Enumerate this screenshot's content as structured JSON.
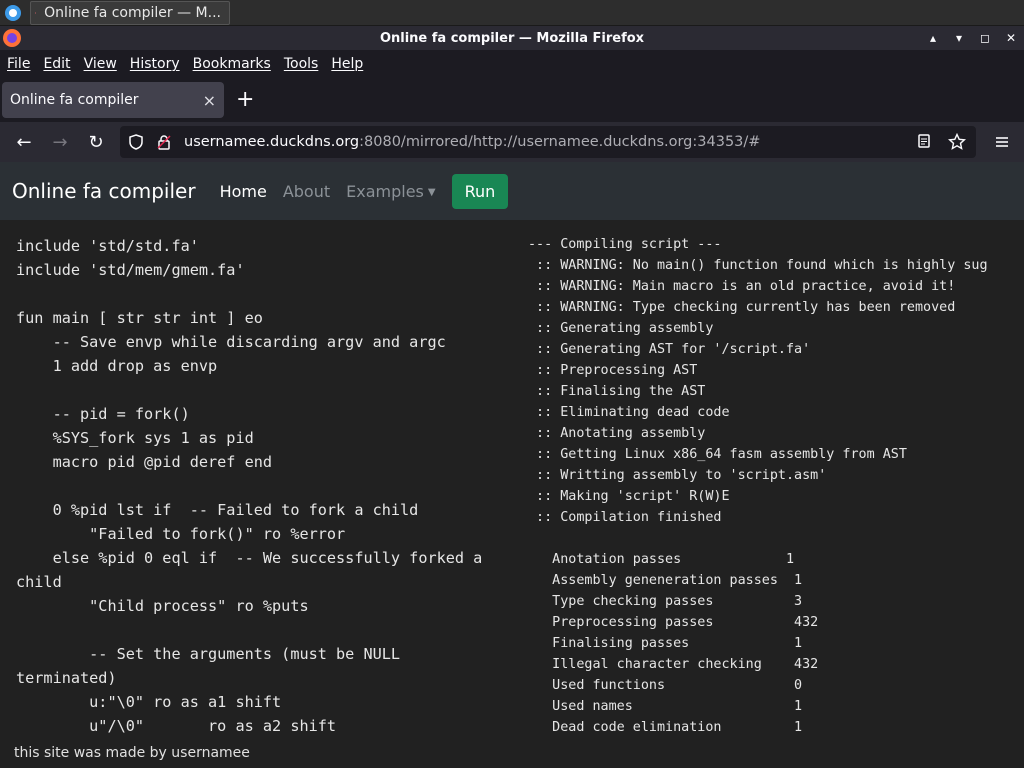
{
  "taskbar": {
    "task_title": "Online fa compiler — M..."
  },
  "window": {
    "title": "Online fa compiler — Mozilla Firefox",
    "minimize": "▴",
    "restore": "▾",
    "maximize": "◻",
    "close": "✕"
  },
  "menu": [
    "File",
    "Edit",
    "View",
    "History",
    "Bookmarks",
    "Tools",
    "Help"
  ],
  "tab": {
    "label": "Online fa compiler",
    "close": "×",
    "newtab": "+"
  },
  "nav": {
    "back": "←",
    "forward": "→",
    "reload": "↻",
    "url_host": "usernamee.duckdns.org",
    "url_rest": ":8080/mirrored/http://usernamee.duckdns.org:34353/#"
  },
  "page": {
    "brand": "Online fa compiler",
    "links": {
      "home": "Home",
      "about": "About",
      "examples": "Examples"
    },
    "run": "Run"
  },
  "editor_text": "include 'std/std.fa'\ninclude 'std/mem/gmem.fa'\n\nfun main [ str str int ] eo\n    -- Save envp while discarding argv and argc\n    1 add drop as envp\n\n    -- pid = fork()\n    %SYS_fork sys 1 as pid\n    macro pid @pid deref end\n\n    0 %pid lst if  -- Failed to fork a child\n        \"Failed to fork()\" ro %error\n    else %pid 0 eql if  -- We successfully forked a child\n        \"Child process\" ro %puts\n\n        -- Set the arguments (must be NULL terminated)\n        u:\"\\0\" ro as a1 shift\n        u\"/\\0\"       ro as a2 shift",
  "output_text": "--- Compiling script ---\n :: WARNING: No main() function found which is highly sug\n :: WARNING: Main macro is an old practice, avoid it!\n :: WARNING: Type checking currently has been removed\n :: Generating assembly\n :: Generating AST for '/script.fa'\n :: Preprocessing AST\n :: Finalising the AST\n :: Eliminating dead code\n :: Anotating assembly\n :: Getting Linux x86_64 fasm assembly from AST\n :: Writting assembly to 'script.asm'\n :: Making 'script' R(W)E\n :: Compilation finished\n\n   Anotation passes             1\n   Assembly geneneration passes  1\n   Type checking passes          3\n   Preprocessing passes          432\n   Finalising passes             1\n   Illegal character checking    432\n   Used functions                0\n   Used names                    1\n   Dead code elimination         1",
  "footer": "this site was made by usernamee"
}
